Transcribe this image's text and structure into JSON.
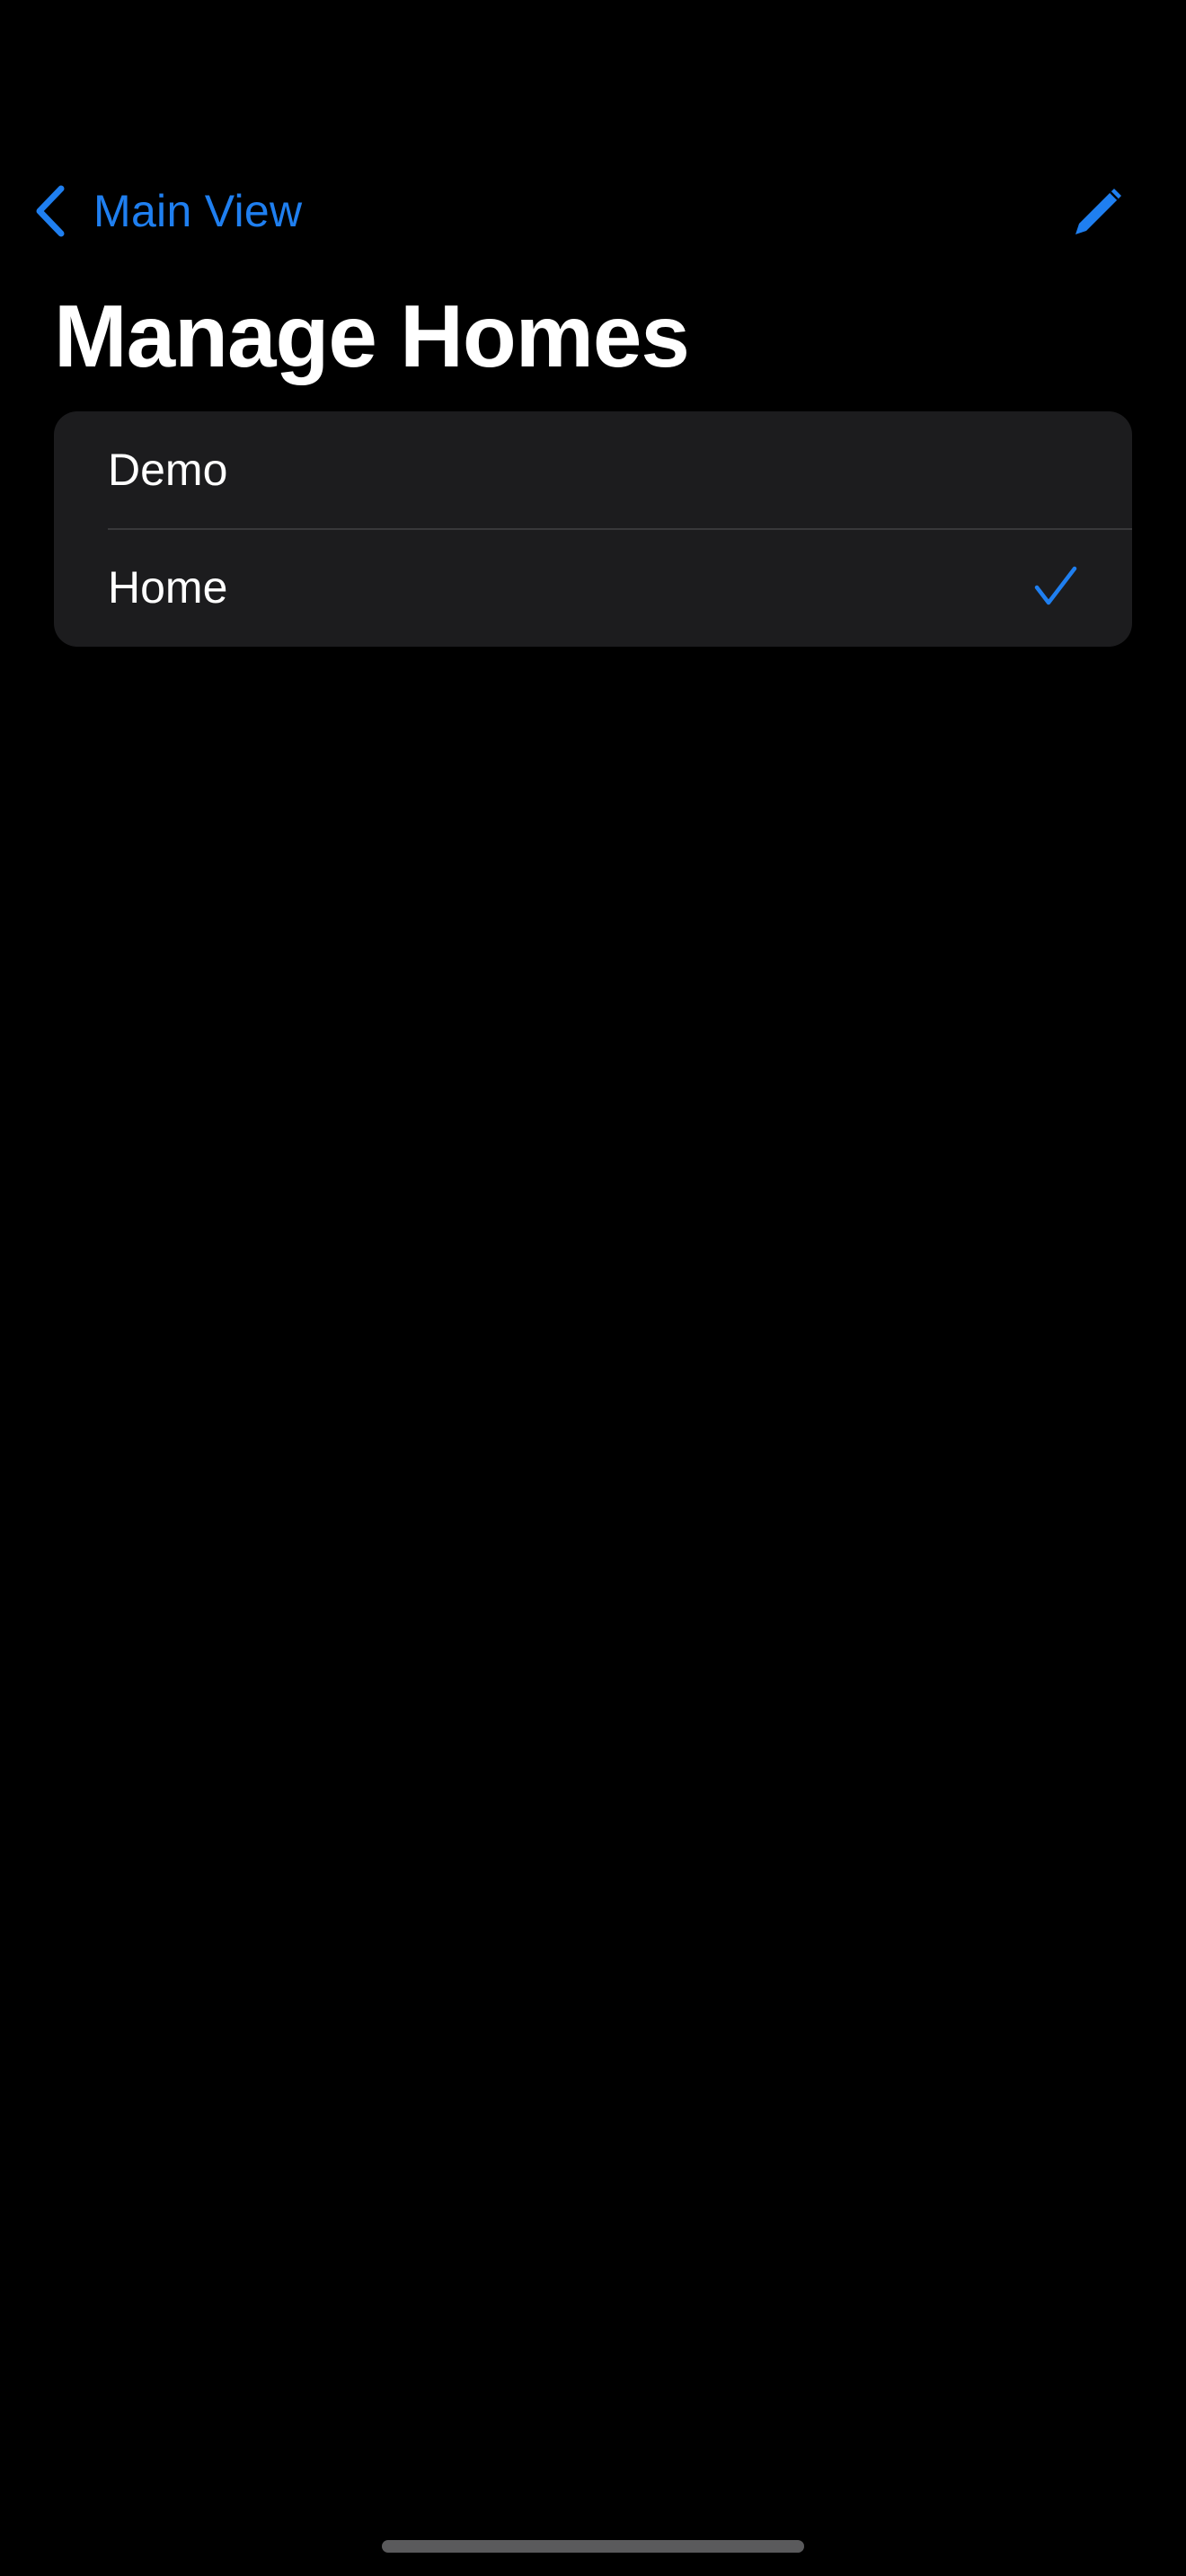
{
  "nav": {
    "back_label": "Main View",
    "back_icon": "chevron-left-icon",
    "edit_icon": "pencil-icon"
  },
  "page": {
    "title": "Manage Homes"
  },
  "homes": [
    {
      "label": "Demo",
      "selected": false
    },
    {
      "label": "Home",
      "selected": true
    }
  ],
  "colors": {
    "accent": "#1f7ff0",
    "background": "#000000",
    "group_background": "#1c1c1e",
    "separator": "#38383a"
  }
}
